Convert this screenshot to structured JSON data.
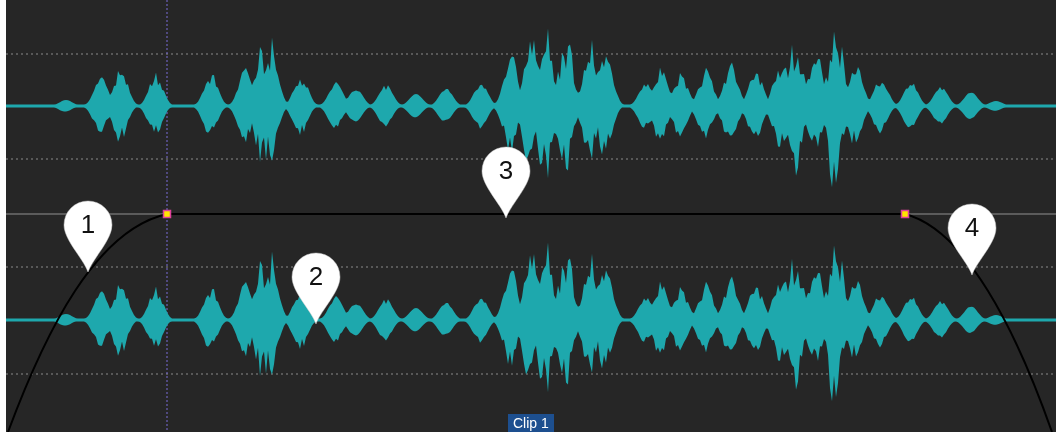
{
  "callouts": [
    {
      "label": "1"
    },
    {
      "label": "2"
    },
    {
      "label": "3"
    },
    {
      "label": "4"
    }
  ],
  "clip": {
    "label": "Clip 1"
  }
}
